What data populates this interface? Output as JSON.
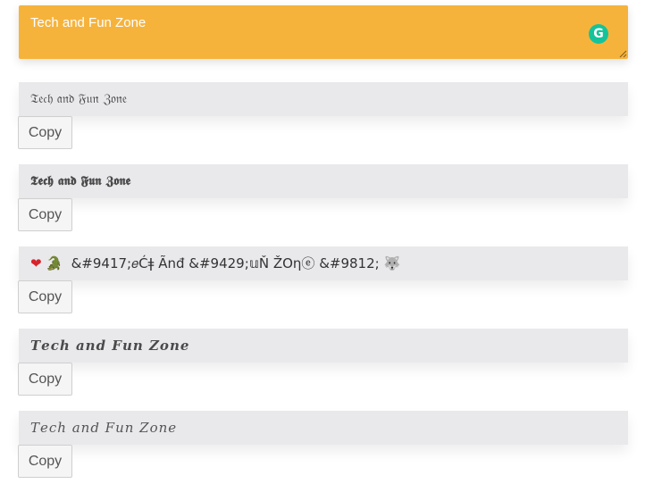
{
  "input": {
    "value": "Tech and Fun Zone",
    "grammarly_badge": "G"
  },
  "results": [
    {
      "text": "𝔗𝔢𝔠𝔥 𝔞𝔫𝔡 𝔉𝔲𝔫 ℨ𝔬𝔫𝔢",
      "copy_label": "Copy"
    },
    {
      "text": "𝕿𝖊𝖈𝖍 𝖆𝖓𝖉 𝕱𝖚𝖓 𝖅𝖔𝖓𝖊",
      "copy_label": "Copy"
    },
    {
      "prefix_icon_1": "❤",
      "prefix_icon_2": "🐊",
      "text": "&#9417;𝑒Ćǂ Ãnđ &#9429;𝕦Ň ŽOηⓔ &#9812;",
      "suffix_icon": "🐺",
      "copy_label": "Copy"
    },
    {
      "text": "𝑻𝒆𝒄𝒉 𝒂𝒏𝒅 𝑭𝒖𝒏 𝒁𝒐𝒏𝒆",
      "copy_label": "Copy"
    },
    {
      "text": "𝑇𝑒𝑐ℎ 𝑎𝑛𝑑 𝐹𝑢𝑛 𝑍𝑜𝑛𝑒",
      "copy_label": "Copy"
    }
  ],
  "colors": {
    "input_background": "#f6b33c",
    "result_background": "#e9e9ec",
    "grammarly": "#15c39a"
  }
}
